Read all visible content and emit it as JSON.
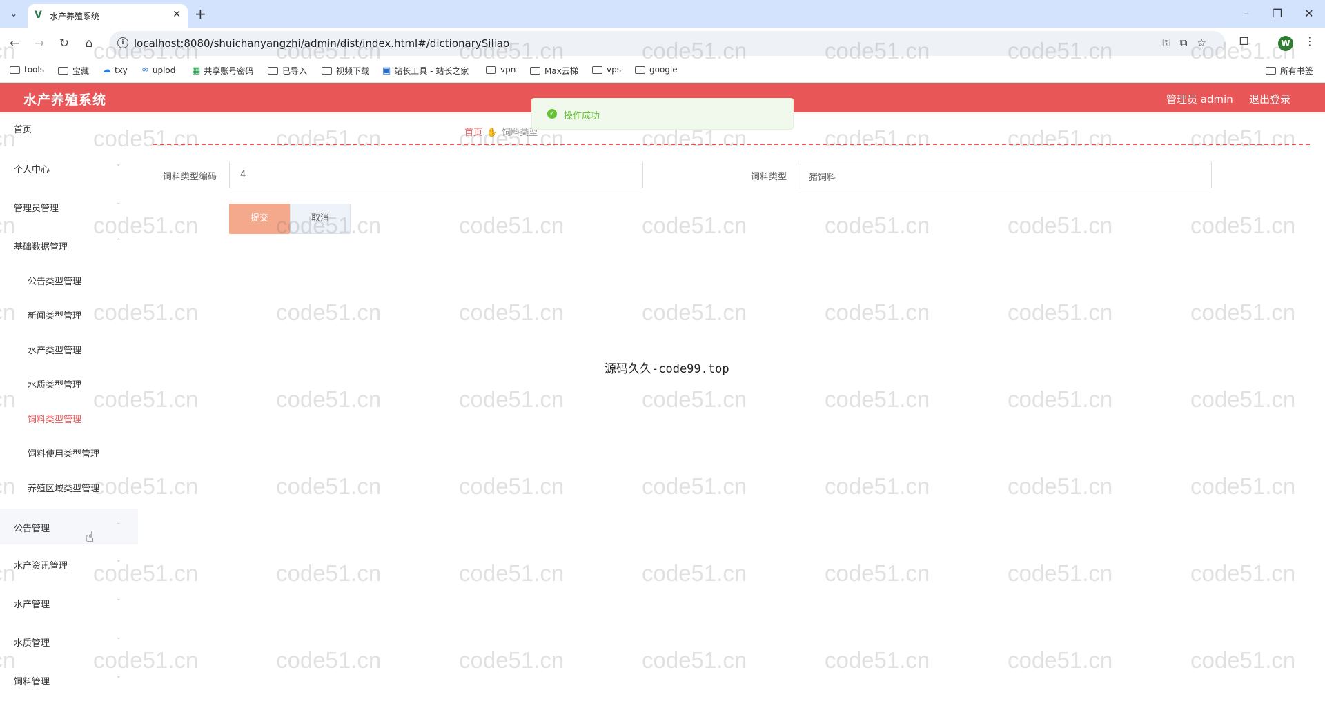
{
  "browser": {
    "tab_title": "水产养殖系统",
    "url": "localhost:8080/shuichanyangzhi/admin/dist/index.html#/dictionarySiliao",
    "profile_initial": "W",
    "bookmarks": [
      "tools",
      "宝藏",
      "txy",
      "uplod",
      "共享账号密码",
      "已导入",
      "视频下载",
      "站长工具 - 站长之家",
      "vpn",
      "Max云梯",
      "vps",
      "google"
    ],
    "all_bookmarks": "所有书签"
  },
  "header": {
    "title": "水产养殖系统",
    "user_label": "管理员 admin",
    "logout_label": "退出登录"
  },
  "toast": {
    "message": "操作成功",
    "color": "#67c23a"
  },
  "sidebar": {
    "items": [
      {
        "label": "首页"
      },
      {
        "label": "个人中心"
      },
      {
        "label": "管理员管理"
      },
      {
        "label": "基础数据管理"
      },
      {
        "label": "公告类型管理"
      },
      {
        "label": "新闻类型管理"
      },
      {
        "label": "水产类型管理"
      },
      {
        "label": "水质类型管理"
      },
      {
        "label": "饲料类型管理"
      },
      {
        "label": "饲料使用类型管理"
      },
      {
        "label": "养殖区域类型管理"
      },
      {
        "label": "公告管理"
      },
      {
        "label": "水产资讯管理"
      },
      {
        "label": "水产管理"
      },
      {
        "label": "水质管理"
      },
      {
        "label": "饲料管理"
      }
    ],
    "active_color": "#e95657"
  },
  "breadcrumb": {
    "home": "首页",
    "current": "饲料类型"
  },
  "form": {
    "code_label": "饲料类型编码",
    "code_value": "4",
    "type_label": "饲料类型",
    "type_value": "猪饲料",
    "submit_label": "提交",
    "cancel_label": "取消"
  },
  "center_note": "源码久久-code99.top",
  "watermark": "code51.cn",
  "colors": {
    "header_bg": "#e95657",
    "submit_bg": "#f4a98d"
  }
}
